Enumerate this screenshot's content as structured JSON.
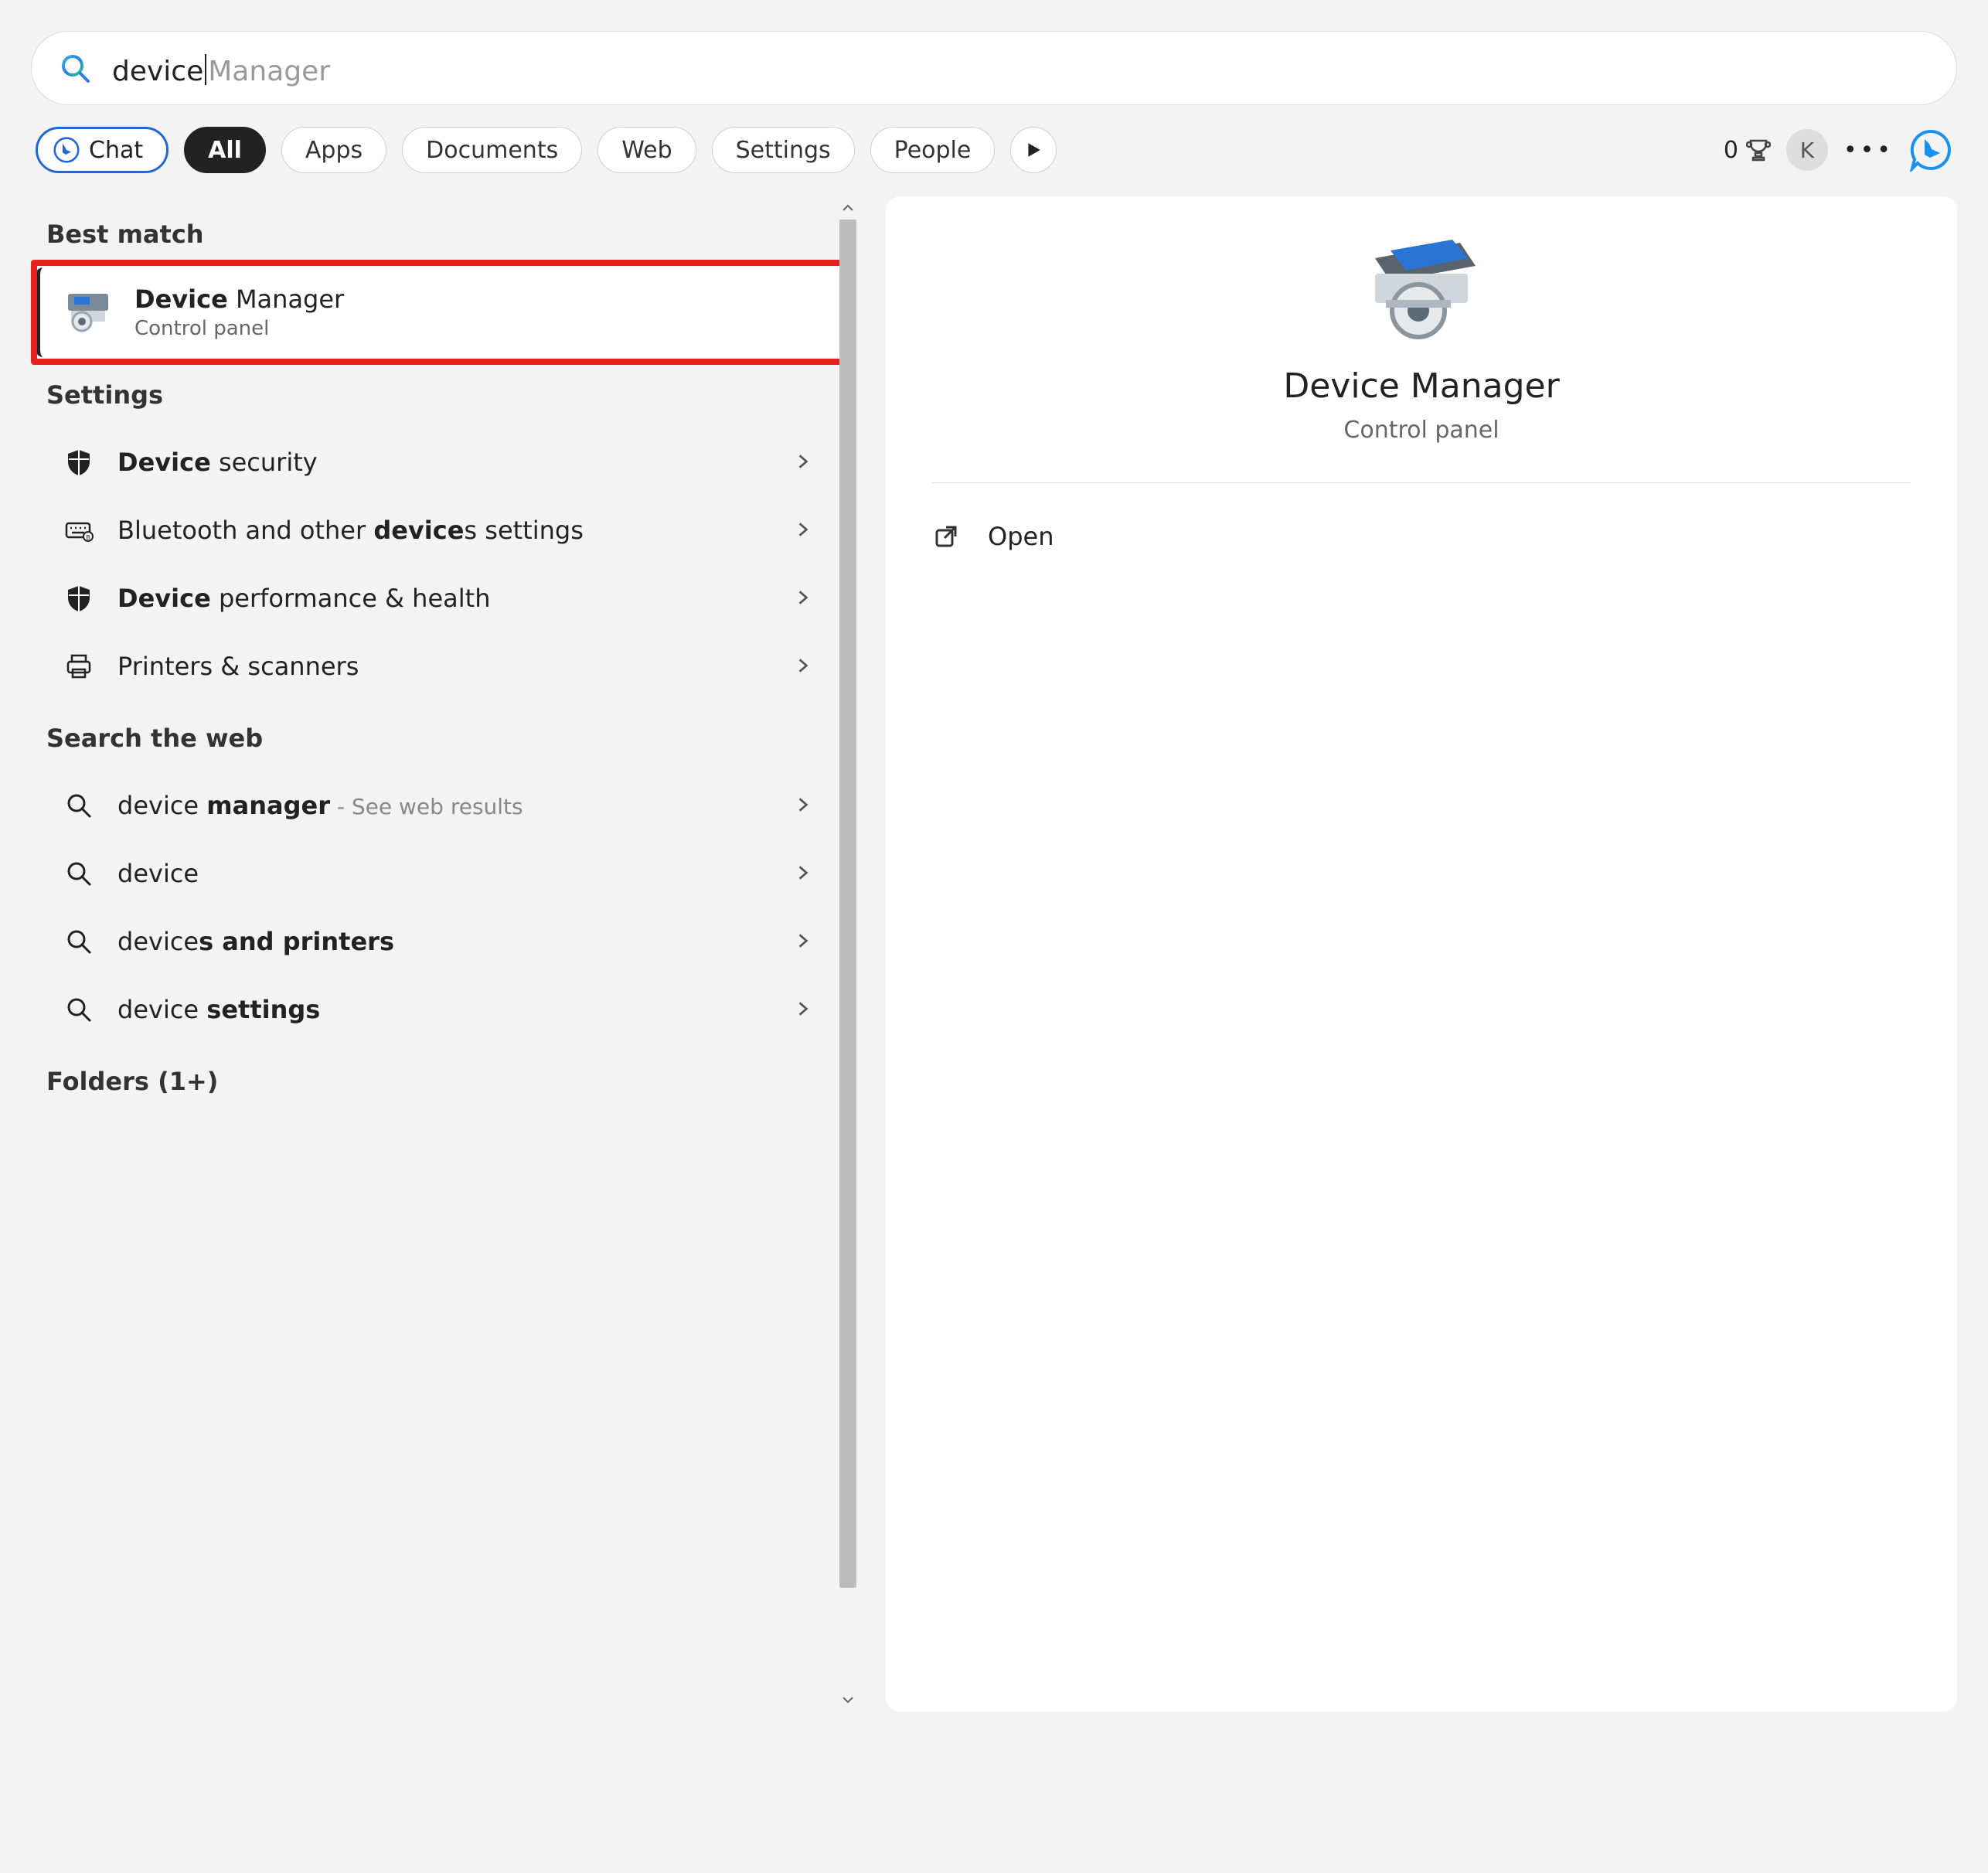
{
  "search": {
    "typed": "device",
    "suggested": " Manager"
  },
  "filters": {
    "chat": "Chat",
    "all": "All",
    "apps": "Apps",
    "documents": "Documents",
    "web": "Web",
    "settings": "Settings",
    "people": "People"
  },
  "rewards": {
    "points": "0"
  },
  "avatar": {
    "initial": "K"
  },
  "left": {
    "best_match_header": "Best match",
    "best_match": {
      "title_bold": "Device",
      "title_rest": " Manager",
      "subtitle": "Control panel"
    },
    "settings_header": "Settings",
    "settings_items": [
      {
        "bold": "Device",
        "rest": " security"
      },
      {
        "bold": "device",
        "pre": "Bluetooth and other ",
        "rest": "s settings"
      },
      {
        "bold": "Device",
        "rest": " performance & health"
      },
      {
        "plain": "Printers & scanners"
      }
    ],
    "web_header": "Search the web",
    "web_items": [
      {
        "pre": "device ",
        "bold": "manager",
        "hint": " - See web results"
      },
      {
        "plain": "device"
      },
      {
        "pre": "device",
        "bold": "s and printers"
      },
      {
        "pre": "device ",
        "bold": "settings"
      }
    ],
    "folders_header": "Folders (1+)"
  },
  "detail": {
    "title": "Device Manager",
    "subtitle": "Control panel",
    "open": "Open"
  }
}
